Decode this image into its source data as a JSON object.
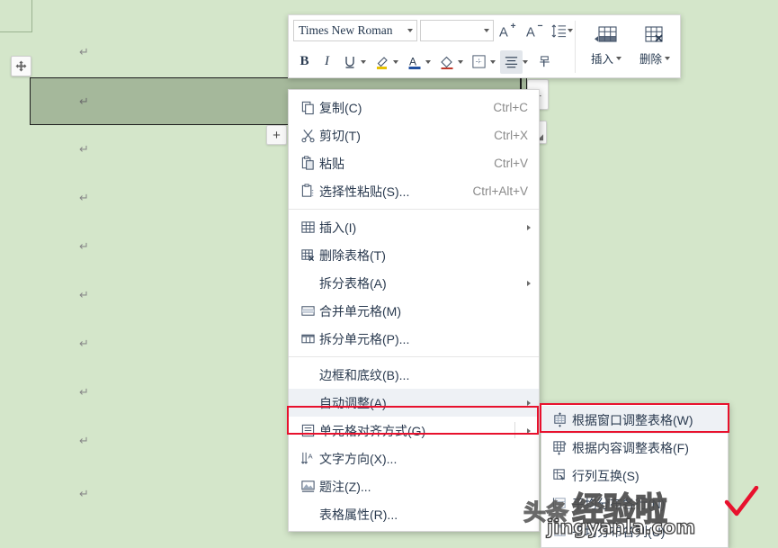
{
  "app": {
    "background_color": "#d4e6ca",
    "selected_row_color": "#a5b89b"
  },
  "document": {
    "pilcrow_char": "↵",
    "paragraph_marks": 10
  },
  "table": {
    "move_handle_icon": "move-cross-icon",
    "insert_button_label": "+",
    "minus_button_label": "–",
    "resize_handle_icon": "resize-handle-icon"
  },
  "mini_toolbar": {
    "font_name": "Times New Roman",
    "font_size": "",
    "buttons": [
      {
        "name": "grow-font",
        "label": "A⁺"
      },
      {
        "name": "shrink-font",
        "label": "A⁻"
      },
      {
        "name": "line-spacing",
        "label": "line-spacing-icon"
      },
      {
        "name": "bold",
        "label": "B"
      },
      {
        "name": "italic",
        "label": "I"
      },
      {
        "name": "underline",
        "label": "U"
      },
      {
        "name": "highlight",
        "label": "highlighter-icon"
      },
      {
        "name": "font-color",
        "label": "A"
      },
      {
        "name": "shading",
        "label": "paint-bucket-icon"
      },
      {
        "name": "borders",
        "label": "borders-icon"
      },
      {
        "name": "align",
        "label": "align-icon"
      },
      {
        "name": "format-painter",
        "label": "format-painter-icon"
      }
    ],
    "insert_label": "插入",
    "delete_label": "删除"
  },
  "context_menu": {
    "groups": [
      {
        "items": [
          {
            "icon": "copy-icon",
            "label": "复制(C)",
            "accel": "Ctrl+C",
            "submenu": false,
            "highlighted": false
          },
          {
            "icon": "cut-icon",
            "label": "剪切(T)",
            "accel": "Ctrl+X",
            "submenu": false,
            "highlighted": false
          },
          {
            "icon": "paste-icon",
            "label": "粘贴",
            "accel": "Ctrl+V",
            "submenu": false,
            "highlighted": false
          },
          {
            "icon": "paste-special-icon",
            "label": "选择性粘贴(S)...",
            "accel": "Ctrl+Alt+V",
            "submenu": false,
            "highlighted": false
          }
        ]
      },
      {
        "items": [
          {
            "icon": "insert-table-icon",
            "label": "插入(I)",
            "accel": "",
            "submenu": true,
            "highlighted": false
          },
          {
            "icon": "delete-table-icon",
            "label": "删除表格(T)",
            "accel": "",
            "submenu": false,
            "highlighted": false
          },
          {
            "icon": "",
            "label": "拆分表格(A)",
            "accel": "",
            "submenu": true,
            "highlighted": false
          },
          {
            "icon": "merge-cells-icon",
            "label": "合并单元格(M)",
            "accel": "",
            "submenu": false,
            "highlighted": false
          },
          {
            "icon": "split-cells-icon",
            "label": "拆分单元格(P)...",
            "accel": "",
            "submenu": false,
            "highlighted": false
          }
        ]
      },
      {
        "items": [
          {
            "icon": "",
            "label": "边框和底纹(B)...",
            "accel": "",
            "submenu": false,
            "highlighted": false
          },
          {
            "icon": "",
            "label": "自动调整(A)",
            "accel": "",
            "submenu": true,
            "highlighted": true
          },
          {
            "icon": "cell-align-icon",
            "label": "单元格对齐方式(G)",
            "accel": "",
            "submenu": true,
            "highlighted": false
          },
          {
            "icon": "text-direction-icon",
            "label": "文字方向(X)...",
            "accel": "",
            "submenu": false,
            "highlighted": false
          },
          {
            "icon": "caption-icon",
            "label": "题注(Z)...",
            "accel": "",
            "submenu": false,
            "highlighted": false
          },
          {
            "icon": "",
            "label": "表格属性(R)...",
            "accel": "",
            "submenu": false,
            "highlighted": false
          }
        ]
      }
    ]
  },
  "submenu": {
    "items": [
      {
        "icon": "fit-window-icon",
        "label": "根据窗口调整表格(W)",
        "highlighted": true
      },
      {
        "icon": "fit-content-icon",
        "label": "根据内容调整表格(F)",
        "highlighted": false
      },
      {
        "icon": "transpose-icon",
        "label": "行列互换(S)",
        "highlighted": false
      },
      {
        "icon": "distribute-rows-icon",
        "label": "平均分布各行(N)",
        "highlighted": false
      },
      {
        "icon": "distribute-columns-icon",
        "label": "平均分布各列(U)",
        "highlighted": false
      }
    ]
  },
  "watermark": {
    "big_text": "经验啦",
    "overlay_text": "头条",
    "url": "jingyanla.com",
    "check_color": "#e8112d"
  }
}
